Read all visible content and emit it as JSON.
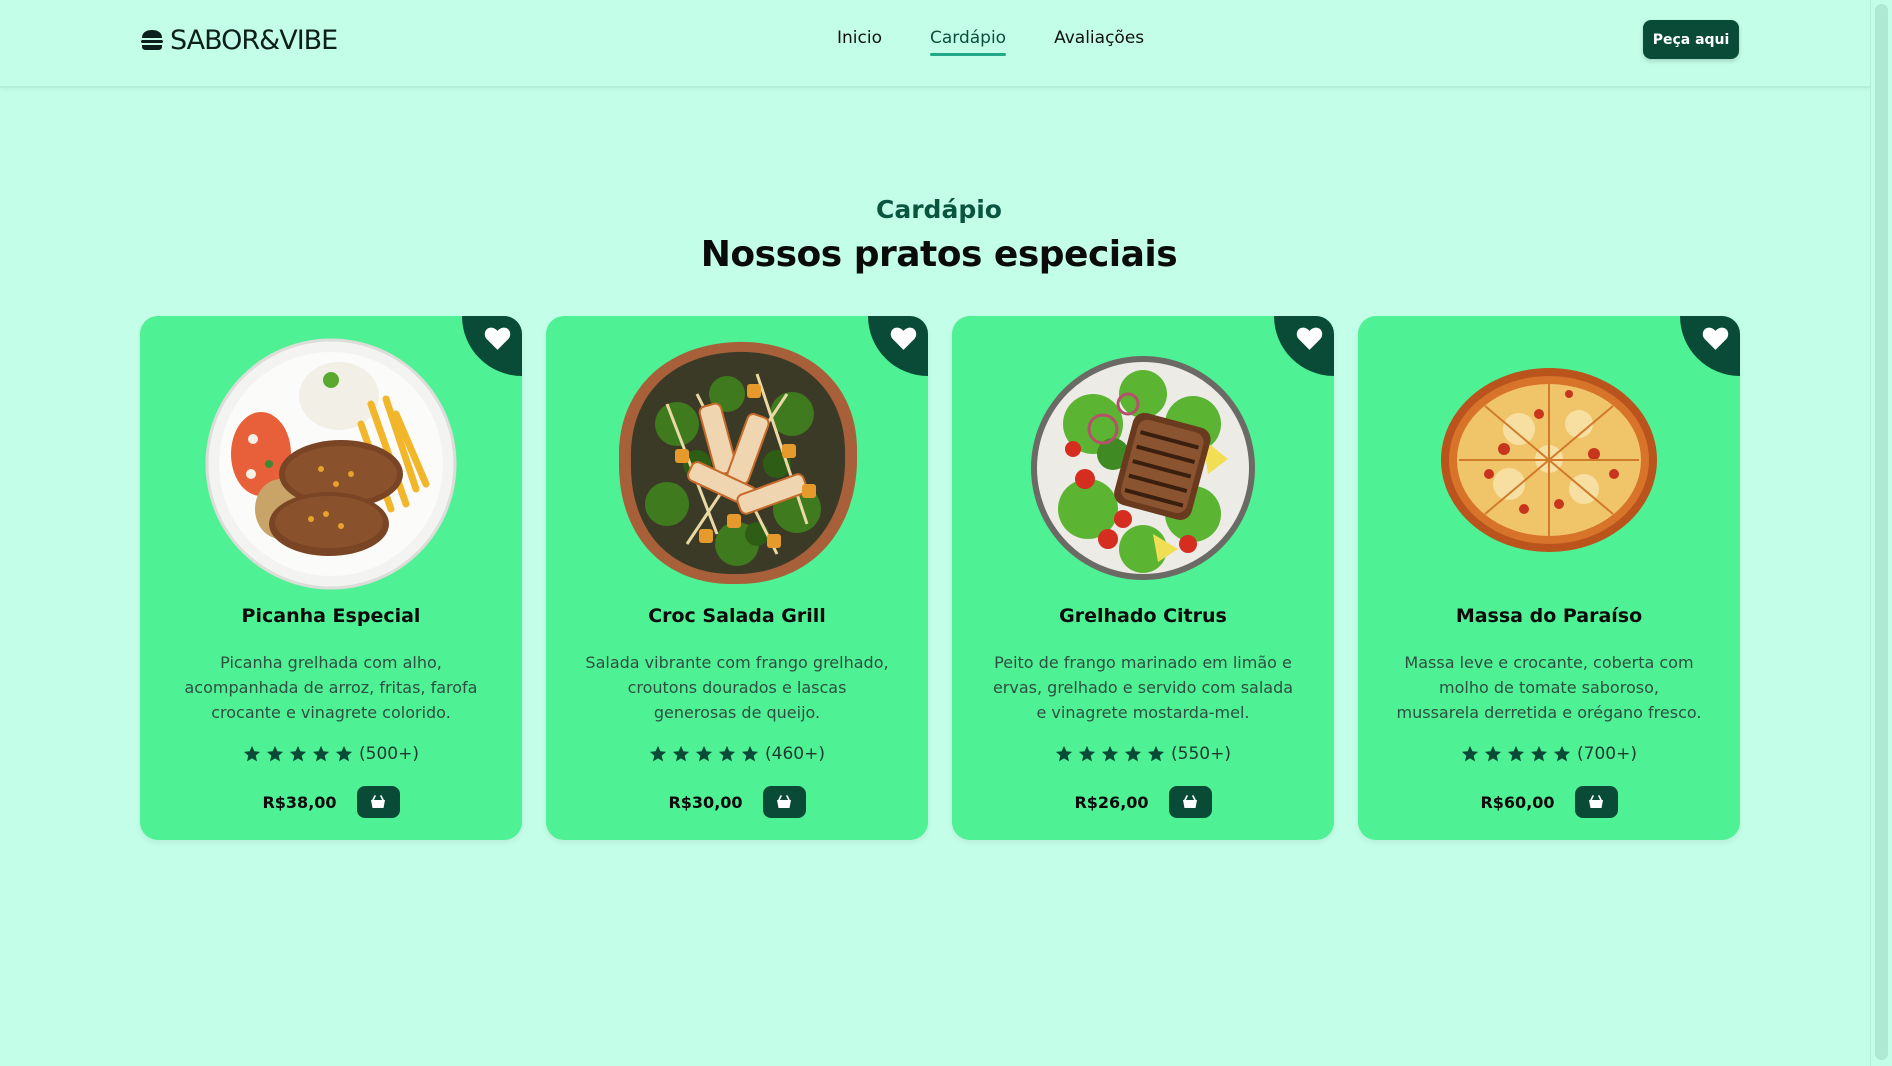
{
  "brand": {
    "name": "SABOR&VIBE",
    "icon": "burger-icon"
  },
  "nav": [
    {
      "label": "Inicio",
      "active": false
    },
    {
      "label": "Cardápio",
      "active": true
    },
    {
      "label": "Avaliações",
      "active": false
    }
  ],
  "cta": {
    "label": "Peça aqui"
  },
  "section": {
    "kicker": "Cardápio",
    "title": "Nossos pratos especiais"
  },
  "colors": {
    "background": "#c3fee8",
    "card": "#4ff195",
    "accent": "#0a4b37",
    "star": "#0a4b37"
  },
  "cards": [
    {
      "name": "Picanha Especial",
      "description": "Picanha grelhada com alho, acompanhada de arroz, fritas, farofa crocante e vinagrete colorido.",
      "rating": 5,
      "reviews": "(500+)",
      "price": "R$38,00",
      "image": "picanha-dish-image"
    },
    {
      "name": "Croc Salada Grill",
      "description": "Salada vibrante com frango grelhado, croutons dourados e lascas generosas de queijo.",
      "rating": 5,
      "reviews": "(460+)",
      "price": "R$30,00",
      "image": "salad-dish-image"
    },
    {
      "name": "Grelhado Citrus",
      "description": "Peito de frango marinado em limão e ervas, grelhado e servido com salada e vinagrete mostarda-mel.",
      "rating": 5,
      "reviews": "(550+)",
      "price": "R$26,00",
      "image": "grilled-citrus-dish-image"
    },
    {
      "name": "Massa do Paraíso",
      "description": "Massa leve e crocante, coberta com molho de tomate saboroso, mussarela derretida e orégano fresco.",
      "rating": 5,
      "reviews": "(700+)",
      "price": "R$60,00",
      "image": "pizza-dish-image"
    }
  ]
}
